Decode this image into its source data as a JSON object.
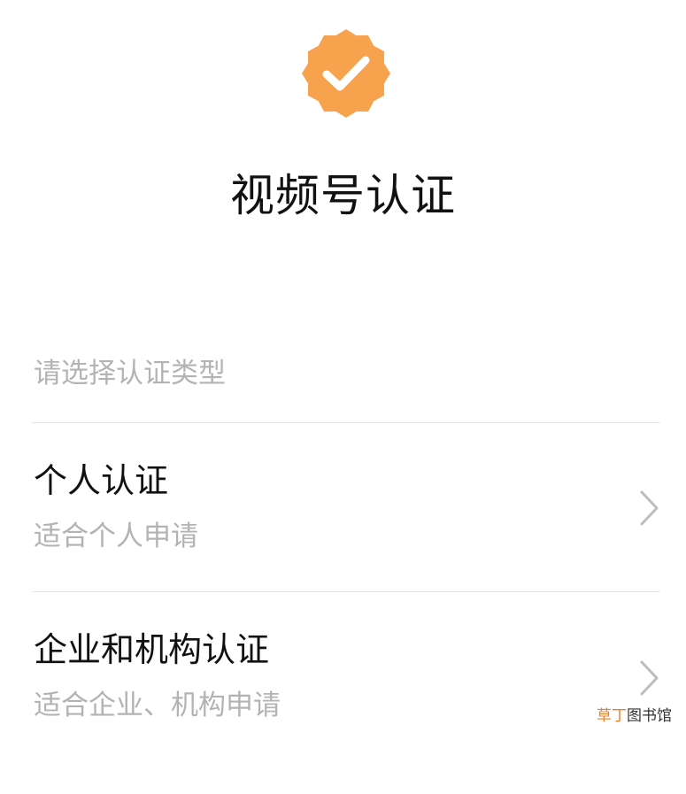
{
  "header": {
    "badge_icon": "verified-badge-icon",
    "badge_color": "#F7A24D",
    "title": "视频号认证"
  },
  "section_label": "请选择认证类型",
  "options": [
    {
      "title": "个人认证",
      "subtitle": "适合个人申请",
      "icon": "chevron-right-icon"
    },
    {
      "title": "企业和机构认证",
      "subtitle": "适合企业、机构申请",
      "icon": "chevron-right-icon"
    }
  ],
  "watermark": {
    "accent": "草丁",
    "rest": "图书馆",
    "accent_color": "#E8822A"
  }
}
